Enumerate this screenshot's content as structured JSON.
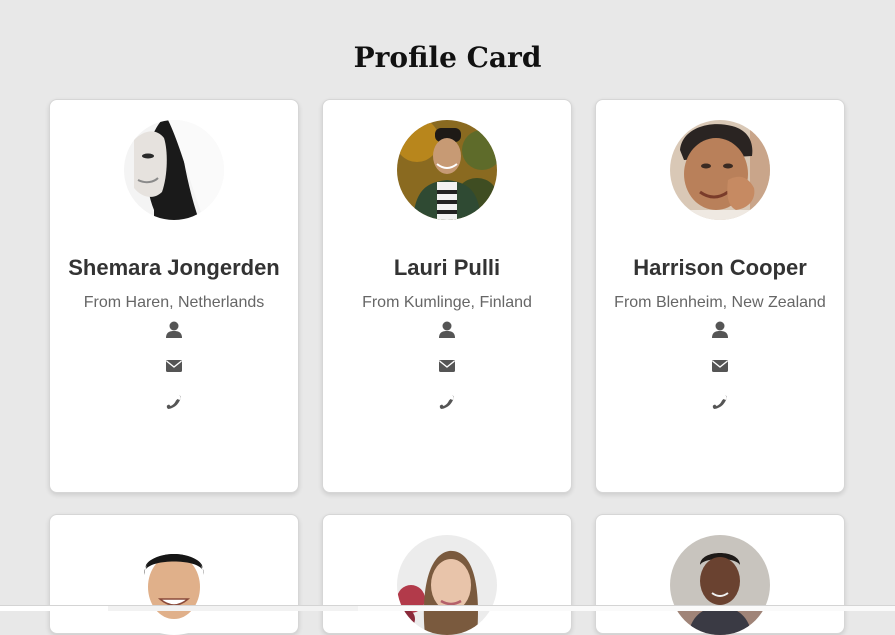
{
  "page": {
    "title": "Profile Card"
  },
  "profiles": [
    {
      "name": "Shemara Jongerden",
      "location": "From Haren, Netherlands",
      "avatar": "woman-bw-portrait"
    },
    {
      "name": "Lauri Pulli",
      "location": "From Kumlinge, Finland",
      "avatar": "man-striped-shirt-portrait"
    },
    {
      "name": "Harrison Cooper",
      "location": "From Blenheim, New Zealand",
      "avatar": "man-hand-gesture-portrait"
    },
    {
      "avatar": "smiling-man-portrait"
    },
    {
      "avatar": "woman-flowers-portrait"
    },
    {
      "avatar": "man-outdoor-portrait"
    }
  ],
  "icons": {
    "profile": "user-icon",
    "email": "envelope-icon",
    "phone": "phone-icon"
  },
  "colors": {
    "background": "#e8e8e8",
    "card": "#ffffff",
    "name_text": "#333333",
    "location_text": "#666666",
    "icon": "#555555"
  }
}
